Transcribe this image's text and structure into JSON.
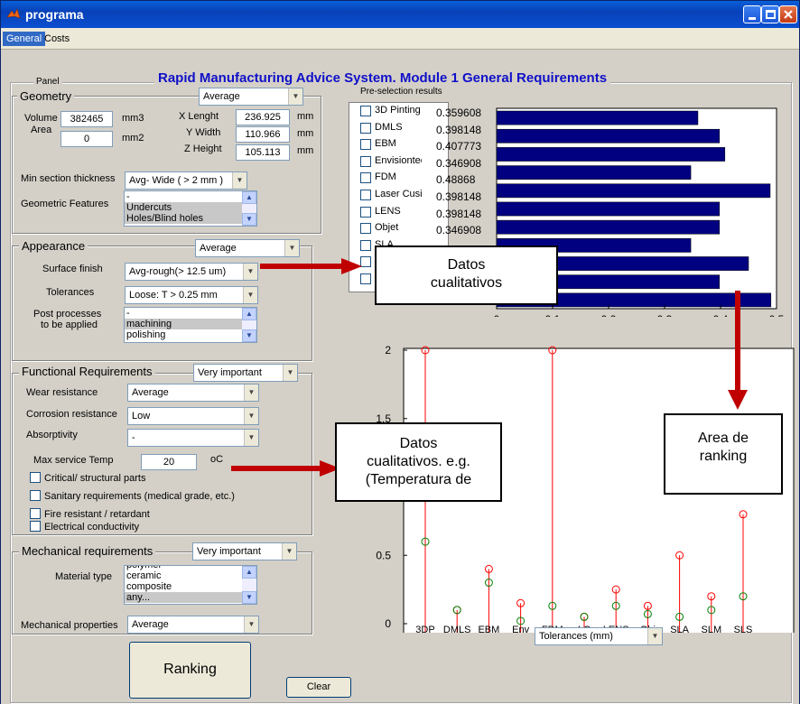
{
  "window": {
    "title": "programa"
  },
  "menu": [
    {
      "label": "General",
      "active": true
    },
    {
      "label": "Costs",
      "active": false
    }
  ],
  "main_title": "Rapid Manufacturing Advice System. Module 1 General Requirements",
  "panel_label": "Panel",
  "geometry": {
    "label": "Geometry",
    "importance": "Average",
    "volume_label": "Volume",
    "volume": "382465",
    "volume_unit": "mm3",
    "area_label": "Area",
    "area": "0",
    "area_unit": "mm2",
    "x_label": "X Lenght",
    "x": "236.925",
    "x_unit": "mm",
    "y_label": "Y Width",
    "y": "110.966",
    "y_unit": "mm",
    "z_label": "Z Height",
    "z": "105.113",
    "z_unit": "mm",
    "min_section_label": "Min section thickness",
    "min_section": "Avg- Wide ( > 2 mm )",
    "features_label": "Geometric Features",
    "features": [
      "-",
      "Undercuts",
      "Holes/Blind holes"
    ]
  },
  "appearance": {
    "label": "Appearance",
    "importance": "Average",
    "surface_label": "Surface finish",
    "surface": "Avg-rough(> 12.5 um)",
    "tolerances_label": "Tolerances",
    "tolerances": "Loose: T > 0.25 mm",
    "post_label_1": "Post processes",
    "post_label_2": "to be applied",
    "post": [
      "-",
      "machining",
      "polishing"
    ]
  },
  "functional": {
    "label": "Functional Requirements",
    "importance": "Very important",
    "wear_label": "Wear resistance",
    "wear": "Average",
    "corrosion_label": "Corrosion resistance",
    "corrosion": "Low",
    "absorptivity_label": "Absorptivity",
    "absorptivity": "-",
    "temp_label": "Max service Temp",
    "temp": "20",
    "temp_unit": "oC",
    "checks": [
      "Critical/ structural parts",
      "Sanitary requirements (medical grade, etc.)",
      "Fire resistant / retardant",
      "Electrical conductivity"
    ]
  },
  "mechanical": {
    "label": "Mechanical requirements",
    "importance": "Very important",
    "material_label": "Material type",
    "materials": [
      "polymer",
      "ceramic",
      "composite",
      "any..."
    ],
    "properties_label": "Mechanical properties",
    "properties": "Average"
  },
  "buttons": {
    "ranking": "Ranking",
    "clear": "Clear"
  },
  "preselection": {
    "label": "Pre-selection results",
    "rows": [
      {
        "name": "3D Pinting",
        "value": "0.359608"
      },
      {
        "name": "DMLS",
        "value": "0.398148"
      },
      {
        "name": "EBM",
        "value": "0.407773"
      },
      {
        "name": "Envisiontec",
        "value": "0.346908"
      },
      {
        "name": "FDM",
        "value": "0.48868"
      },
      {
        "name": "Laser Cusing",
        "value": "0.398148"
      },
      {
        "name": "LENS",
        "value": "0.398148"
      },
      {
        "name": "Objet",
        "value": "0.346908"
      },
      {
        "name": "SLA",
        "value": ""
      },
      {
        "name": "SLM",
        "value": ""
      },
      {
        "name": "SLS",
        "value": ""
      }
    ]
  },
  "callouts": {
    "c1": [
      "Datos",
      "cualitativos"
    ],
    "c2": [
      "Datos",
      "cualitativos. e.g.",
      "(Temperatura de"
    ],
    "c3": [
      "Area de",
      "ranking"
    ]
  },
  "ranking_selector": "Tolerances (mm)",
  "colors": {
    "bar": "#000080",
    "stem": "#ff0000",
    "marker_green": "#008000",
    "arrow": "#c00000"
  },
  "chart_data": [
    {
      "type": "bar",
      "orientation": "horizontal",
      "categories": [
        "3D Pinting",
        "DMLS",
        "EBM",
        "Envisiontec",
        "FDM",
        "Laser Cusing",
        "LENS",
        "Objet",
        "SLA",
        "SLM",
        "SLS"
      ],
      "values": [
        0.359608,
        0.398148,
        0.407773,
        0.346908,
        0.48868,
        0.398148,
        0.398148,
        0.346908,
        0.45,
        0.398,
        0.49
      ],
      "xlim": [
        0,
        0.5
      ],
      "xticks": [
        "0",
        "0.1",
        "0.2",
        "0.3",
        "0.4",
        "0.5"
      ]
    },
    {
      "type": "scatter",
      "style": "stem",
      "categories": [
        "3DP",
        "DMLS",
        "EBM",
        "Env",
        "FDM",
        "LC",
        "LENS",
        "Obj",
        "SLA",
        "SLM",
        "SLS"
      ],
      "red": [
        2,
        0.1,
        0.4,
        0.15,
        2,
        0.05,
        0.25,
        0.13,
        0.5,
        0.2,
        0.8
      ],
      "green": [
        0.6,
        0.1,
        0.3,
        0.02,
        0.13,
        0.05,
        0.13,
        0.07,
        0.05,
        0.1,
        0.2
      ],
      "ylim": [
        0,
        2
      ],
      "yticks": [
        "0",
        "0.5",
        "1",
        "1.5",
        "2"
      ]
    }
  ]
}
